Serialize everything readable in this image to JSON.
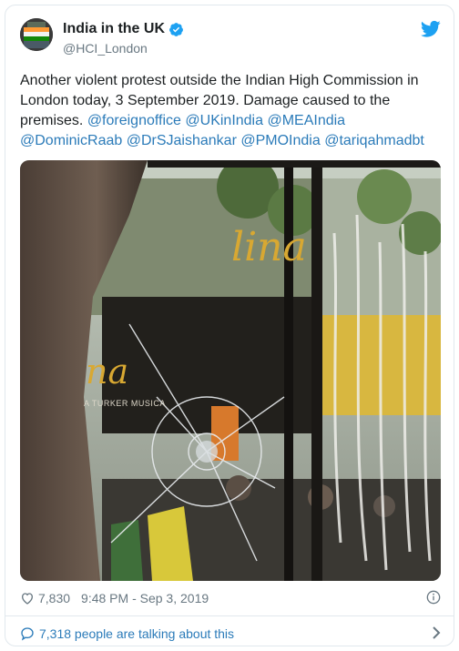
{
  "tweet": {
    "author_name": "India in the UK",
    "author_handle": "@HCI_London",
    "text_plain": "Another violent protest outside the Indian High Commission in London today, 3 September 2019. Damage caused to the premises.",
    "mentions": [
      "@foreignoffice",
      "@UKinIndia",
      "@MEAIndia",
      "@DominicRaab",
      "@DrSJaishankar",
      "@PMOIndia",
      "@tariqahmadbt"
    ],
    "likes": "7,830",
    "timestamp": "9:48 PM - Sep 3, 2019",
    "talking": "7,318 people are talking about this"
  },
  "photo": {
    "sign_text_1": "lina",
    "sign_text_2": "na",
    "small_text": "A TURKER MUSICA"
  },
  "colors": {
    "link": "#2b7bb9",
    "muted": "#697882",
    "verified": "#1da1f2",
    "twitter_bird": "#1da1f2",
    "border": "#e1e8ed"
  },
  "icons": {
    "verified": "verified-badge-icon",
    "bird": "twitter-bird-icon",
    "heart": "heart-icon",
    "info": "info-icon",
    "bubble": "speech-bubble-icon",
    "chevron": "chevron-right-icon"
  }
}
